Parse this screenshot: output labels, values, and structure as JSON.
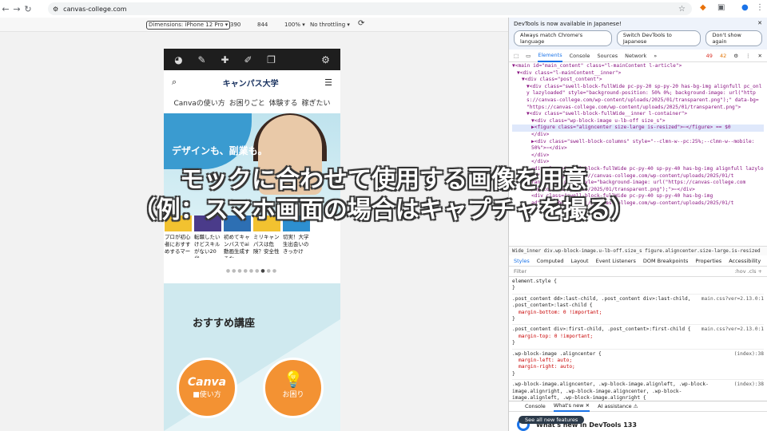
{
  "browser": {
    "url": "canvas-college.com"
  },
  "device": {
    "dimensions": "Dimensions: iPhone 12 Pro ▾",
    "width": "390",
    "height": "844",
    "zoom": "100% ▾",
    "throttle": "No throttling ▾"
  },
  "site": {
    "logo": "キャンパス大学",
    "menu": [
      "Canvaの使い方",
      "お困りごと",
      "体験する",
      "稼ぎたい"
    ],
    "hero_text": "デザインも、副業も。",
    "cards": [
      "プロが初心者におすすめするマー",
      "転職したいけどスキルがない20代",
      "初めてキャンバスでai動画生成するな",
      "ミリキャンパスは危険？安全性",
      "切実！大学生出会いのきっかけ"
    ],
    "section_title": "おすすめ講座",
    "circle1_big": "Canva",
    "circle1_small": "■使い方",
    "circle2_small": "お困り"
  },
  "overlay": {
    "line1": "モックに合わせて使用する画像を用意",
    "line2": "（例：スマホ画面の場合はキャプチャを撮る）"
  },
  "devtools": {
    "notice": "DevTools is now available in Japanese!",
    "btn1": "Always match Chrome's language",
    "btn2": "Switch DevTools to Japanese",
    "btn3": "Don't show again",
    "tabs": [
      "Elements",
      "Console",
      "Sources",
      "Network"
    ],
    "errors": "49",
    "warnings": "42",
    "tree": [
      "▼<main id=\"main_content\" class=\"l-mainContent l-article\">",
      "▼<div class=\"l-mainContent__inner\">",
      "▼<div class=\"post_content\">",
      "▼<div class=\"swell-block-fullWide pc-py-20 sp-py-20 has-bg-img alignfull pc_onl",
      "y lazyloaded\" style=\"background-position: 50% 0%; background-image: url(\"http",
      "s://canvas-college.com/wp-content/uploads/2025/01/transparent.png\");\" data-bg=",
      "\"https://canvas-college.com/wp-content/uploads/2025/01/transparent.png\">",
      "▼<div class=\"swell-block-fullWide__inner l-container\">",
      "▼<div class=\"wp-block-image u-lb-off size_s\">",
      "▶<figure class=\"aligncenter size-large is-resized\">⋯</figure> == $0",
      "</div>",
      "▶<div class=\"swell-block-columns\" style=\"--clmn-w--pc:25%;--clmn-w--mobile:",
      "50%\">⋯</div>",
      "</div>",
      "</div>",
      "<div class=\"swell-block-fullWide pc-py-40 sp-py-40 has-bg-img alignfull lazylo",
      "ad\" data-bg=\"https://canvas-college.com/wp-content/uploads/2025/01/t",
      "ransparent.png\" style=\"background-image: url(\"https://canvas-college.com",
      "/wp-content/uploads/2025/01/transparent.png\");\">⋯</div>",
      "<div class=\"swell-block-fullWide pc-py-40 sp-py-40 has-bg-img",
      "ad\" data-bg=\"https://canvas-college.com/wp-content/uploads/2025/01/t"
    ],
    "crumb": "Wide_inner  div.wp-block-image.u-lb-off.size_s   figure.aligncenter.size-large.is-resized",
    "style_tabs": [
      "Styles",
      "Computed",
      "Layout",
      "Event Listeners",
      "DOM Breakpoints",
      "Properties",
      "Accessibility"
    ],
    "filter": "Filter",
    "filter_right": ":hov .cls +",
    "rules": [
      {
        "sel": "element.style {",
        "props": [],
        "src": ""
      },
      {
        "sel": ".post_content dd>:last-child, .post_content div>:last-child, .post_content>:last-child {",
        "props": [
          "margin-bottom: 0 !important;"
        ],
        "src": "main.css?ver=2.13.0:1"
      },
      {
        "sel": ".post_content div>:first-child, .post_content>:first-child {",
        "props": [
          "margin-top: 0 !important;"
        ],
        "src": "main.css?ver=2.13.0:1"
      },
      {
        "sel": ".wp-block-image .aligncenter {",
        "props": [
          "margin-left: auto;",
          "margin-right: auto;"
        ],
        "src": "(index):38"
      },
      {
        "sel": ".wp-block-image.aligncenter, .wp-block-image.alignleft, .wp-block-image.alignright, .wp-block-image.aligncenter, .wp-block-image.alignleft, .wp-block-image.alignright {",
        "props": [
          "display: table;"
        ],
        "src": "(index):38"
      }
    ],
    "bottom_tabs": [
      "Console",
      "What's new ✕",
      "AI assistance ⚠"
    ],
    "whatsnew": "What's new in DevTools 133",
    "seeall": "See all new features"
  }
}
